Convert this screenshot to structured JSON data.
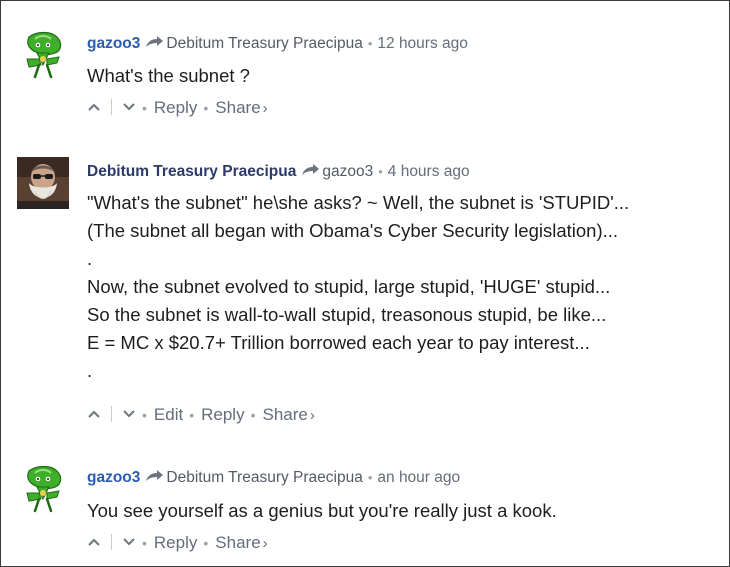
{
  "comments": [
    {
      "author": "gazoo3",
      "reply_to": "Debitum Treasury Praecipua",
      "time": "12 hours ago",
      "body": "What's the subnet ?",
      "actions": {
        "reply": "Reply",
        "share": "Share",
        "share_chevron": "›"
      }
    },
    {
      "author": "Debitum Treasury Praecipua",
      "reply_to": "gazoo3",
      "time": "4 hours ago",
      "body": "\"What's the subnet\" he\\she asks? ~ Well, the subnet is 'STUPID'...\n(The subnet all began with Obama's Cyber Security legislation)...\n.\nNow, the subnet evolved to stupid, large stupid, 'HUGE' stupid...\nSo the subnet is wall-to-wall stupid, treasonous stupid, be like...\nE = MC x $20.7+ Trillion borrowed each year to pay interest...\n.",
      "actions": {
        "edit": "Edit",
        "reply": "Reply",
        "share": "Share",
        "share_chevron": "›"
      }
    },
    {
      "author": "gazoo3",
      "reply_to": "Debitum Treasury Praecipua",
      "time": "an hour ago",
      "body": "You see yourself as a genius but you're really just a kook.",
      "actions": {
        "reply": "Reply",
        "share": "Share",
        "share_chevron": "›"
      }
    }
  ],
  "colors": {
    "author_link": "#2a5db0",
    "meta_gray": "#656c7a",
    "body_text": "#1e1e1e",
    "avatar_green": "#3fae2a"
  },
  "icons": {
    "upvote": "chevron-up-icon",
    "downvote": "chevron-down-icon",
    "reply_to": "reply-arrow-icon",
    "avatar_1": "green-cartoon-avatar",
    "avatar_2": "bearded-man-avatar"
  }
}
